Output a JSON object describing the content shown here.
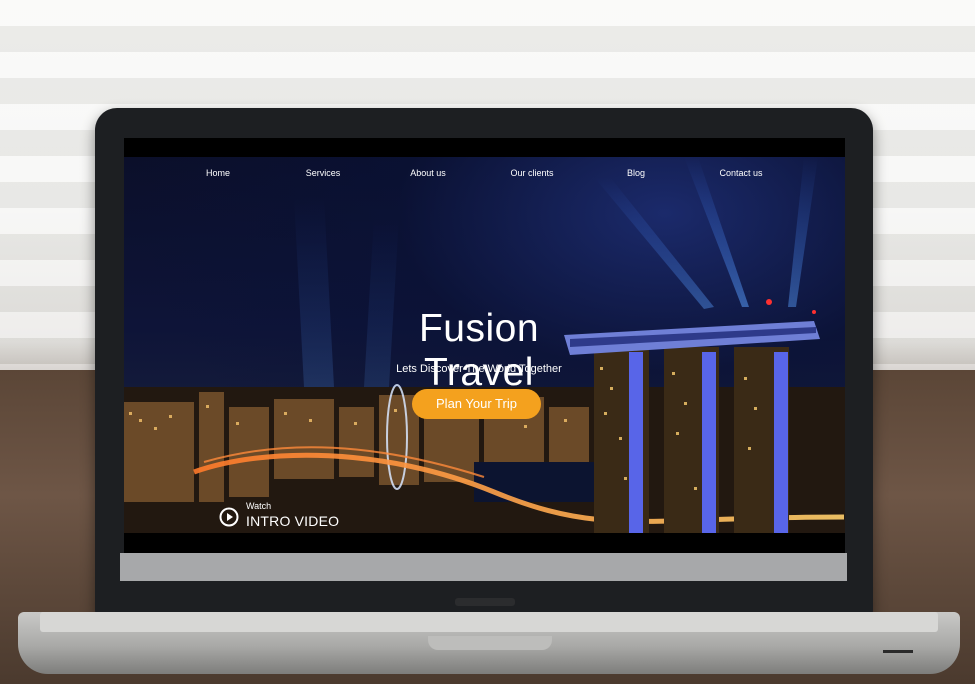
{
  "site": {
    "nav": [
      {
        "label": "Home"
      },
      {
        "label": "Services"
      },
      {
        "label": "About us"
      },
      {
        "label": "Our clients"
      },
      {
        "label": "Blog"
      },
      {
        "label": "Contact us"
      }
    ],
    "hero": {
      "title": "Fusion Travel",
      "subtitle": "Lets Discover The World Together",
      "cta_label": "Plan Your Trip",
      "video_watch": "Watch",
      "video_label": "INTRO VIDEO"
    }
  },
  "colors": {
    "accent": "#f4a11e",
    "text": "#ffffff"
  },
  "icons": {
    "play": "play-icon"
  }
}
